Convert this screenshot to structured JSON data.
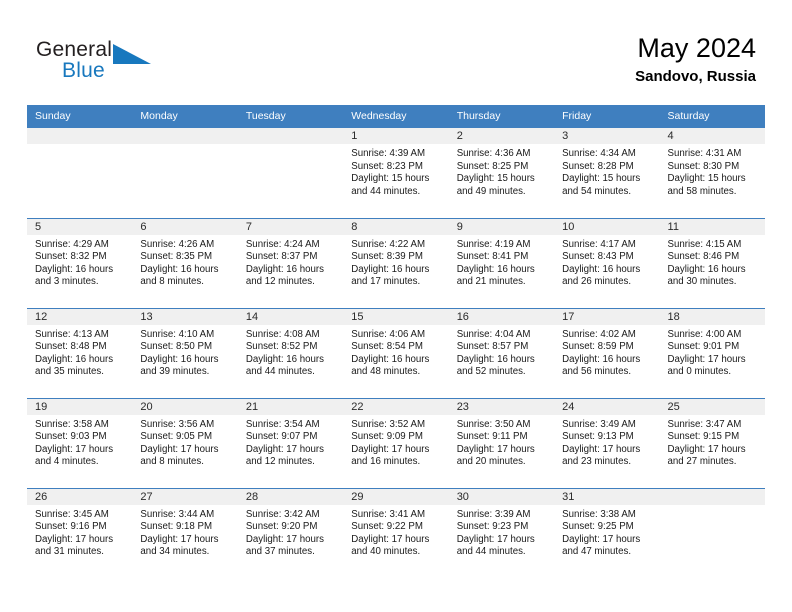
{
  "brand": {
    "name_part1": "General",
    "name_part2": "Blue",
    "triangle_icon": "triangle-icon",
    "accent_color": "#1878be"
  },
  "header": {
    "title": "May 2024",
    "subtitle": "Sandovo, Russia"
  },
  "theme": {
    "header_blue": "#3f7fbf",
    "band_gray": "#f0f0f0"
  },
  "calendar": {
    "weekday_headers": [
      "Sunday",
      "Monday",
      "Tuesday",
      "Wednesday",
      "Thursday",
      "Friday",
      "Saturday"
    ],
    "weeks": [
      [
        {
          "day": "",
          "lines": []
        },
        {
          "day": "",
          "lines": []
        },
        {
          "day": "",
          "lines": []
        },
        {
          "day": "1",
          "lines": [
            "Sunrise: 4:39 AM",
            "Sunset: 8:23 PM",
            "Daylight: 15 hours",
            "and 44 minutes."
          ]
        },
        {
          "day": "2",
          "lines": [
            "Sunrise: 4:36 AM",
            "Sunset: 8:25 PM",
            "Daylight: 15 hours",
            "and 49 minutes."
          ]
        },
        {
          "day": "3",
          "lines": [
            "Sunrise: 4:34 AM",
            "Sunset: 8:28 PM",
            "Daylight: 15 hours",
            "and 54 minutes."
          ]
        },
        {
          "day": "4",
          "lines": [
            "Sunrise: 4:31 AM",
            "Sunset: 8:30 PM",
            "Daylight: 15 hours",
            "and 58 minutes."
          ]
        }
      ],
      [
        {
          "day": "5",
          "lines": [
            "Sunrise: 4:29 AM",
            "Sunset: 8:32 PM",
            "Daylight: 16 hours",
            "and 3 minutes."
          ]
        },
        {
          "day": "6",
          "lines": [
            "Sunrise: 4:26 AM",
            "Sunset: 8:35 PM",
            "Daylight: 16 hours",
            "and 8 minutes."
          ]
        },
        {
          "day": "7",
          "lines": [
            "Sunrise: 4:24 AM",
            "Sunset: 8:37 PM",
            "Daylight: 16 hours",
            "and 12 minutes."
          ]
        },
        {
          "day": "8",
          "lines": [
            "Sunrise: 4:22 AM",
            "Sunset: 8:39 PM",
            "Daylight: 16 hours",
            "and 17 minutes."
          ]
        },
        {
          "day": "9",
          "lines": [
            "Sunrise: 4:19 AM",
            "Sunset: 8:41 PM",
            "Daylight: 16 hours",
            "and 21 minutes."
          ]
        },
        {
          "day": "10",
          "lines": [
            "Sunrise: 4:17 AM",
            "Sunset: 8:43 PM",
            "Daylight: 16 hours",
            "and 26 minutes."
          ]
        },
        {
          "day": "11",
          "lines": [
            "Sunrise: 4:15 AM",
            "Sunset: 8:46 PM",
            "Daylight: 16 hours",
            "and 30 minutes."
          ]
        }
      ],
      [
        {
          "day": "12",
          "lines": [
            "Sunrise: 4:13 AM",
            "Sunset: 8:48 PM",
            "Daylight: 16 hours",
            "and 35 minutes."
          ]
        },
        {
          "day": "13",
          "lines": [
            "Sunrise: 4:10 AM",
            "Sunset: 8:50 PM",
            "Daylight: 16 hours",
            "and 39 minutes."
          ]
        },
        {
          "day": "14",
          "lines": [
            "Sunrise: 4:08 AM",
            "Sunset: 8:52 PM",
            "Daylight: 16 hours",
            "and 44 minutes."
          ]
        },
        {
          "day": "15",
          "lines": [
            "Sunrise: 4:06 AM",
            "Sunset: 8:54 PM",
            "Daylight: 16 hours",
            "and 48 minutes."
          ]
        },
        {
          "day": "16",
          "lines": [
            "Sunrise: 4:04 AM",
            "Sunset: 8:57 PM",
            "Daylight: 16 hours",
            "and 52 minutes."
          ]
        },
        {
          "day": "17",
          "lines": [
            "Sunrise: 4:02 AM",
            "Sunset: 8:59 PM",
            "Daylight: 16 hours",
            "and 56 minutes."
          ]
        },
        {
          "day": "18",
          "lines": [
            "Sunrise: 4:00 AM",
            "Sunset: 9:01 PM",
            "Daylight: 17 hours",
            "and 0 minutes."
          ]
        }
      ],
      [
        {
          "day": "19",
          "lines": [
            "Sunrise: 3:58 AM",
            "Sunset: 9:03 PM",
            "Daylight: 17 hours",
            "and 4 minutes."
          ]
        },
        {
          "day": "20",
          "lines": [
            "Sunrise: 3:56 AM",
            "Sunset: 9:05 PM",
            "Daylight: 17 hours",
            "and 8 minutes."
          ]
        },
        {
          "day": "21",
          "lines": [
            "Sunrise: 3:54 AM",
            "Sunset: 9:07 PM",
            "Daylight: 17 hours",
            "and 12 minutes."
          ]
        },
        {
          "day": "22",
          "lines": [
            "Sunrise: 3:52 AM",
            "Sunset: 9:09 PM",
            "Daylight: 17 hours",
            "and 16 minutes."
          ]
        },
        {
          "day": "23",
          "lines": [
            "Sunrise: 3:50 AM",
            "Sunset: 9:11 PM",
            "Daylight: 17 hours",
            "and 20 minutes."
          ]
        },
        {
          "day": "24",
          "lines": [
            "Sunrise: 3:49 AM",
            "Sunset: 9:13 PM",
            "Daylight: 17 hours",
            "and 23 minutes."
          ]
        },
        {
          "day": "25",
          "lines": [
            "Sunrise: 3:47 AM",
            "Sunset: 9:15 PM",
            "Daylight: 17 hours",
            "and 27 minutes."
          ]
        }
      ],
      [
        {
          "day": "26",
          "lines": [
            "Sunrise: 3:45 AM",
            "Sunset: 9:16 PM",
            "Daylight: 17 hours",
            "and 31 minutes."
          ]
        },
        {
          "day": "27",
          "lines": [
            "Sunrise: 3:44 AM",
            "Sunset: 9:18 PM",
            "Daylight: 17 hours",
            "and 34 minutes."
          ]
        },
        {
          "day": "28",
          "lines": [
            "Sunrise: 3:42 AM",
            "Sunset: 9:20 PM",
            "Daylight: 17 hours",
            "and 37 minutes."
          ]
        },
        {
          "day": "29",
          "lines": [
            "Sunrise: 3:41 AM",
            "Sunset: 9:22 PM",
            "Daylight: 17 hours",
            "and 40 minutes."
          ]
        },
        {
          "day": "30",
          "lines": [
            "Sunrise: 3:39 AM",
            "Sunset: 9:23 PM",
            "Daylight: 17 hours",
            "and 44 minutes."
          ]
        },
        {
          "day": "31",
          "lines": [
            "Sunrise: 3:38 AM",
            "Sunset: 9:25 PM",
            "Daylight: 17 hours",
            "and 47 minutes."
          ]
        },
        {
          "day": "",
          "lines": []
        }
      ]
    ]
  }
}
